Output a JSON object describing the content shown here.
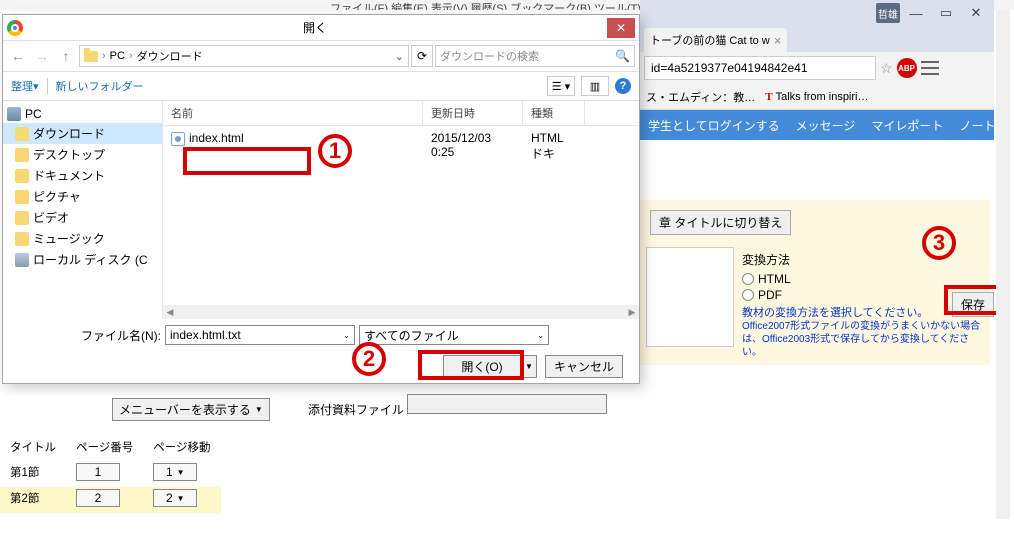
{
  "top_menu": "ファイル(F)   編集(E)   表示(V)   履歴(S)   ブックマーク(B)   ツール(T)   ヘルプ(H)",
  "browser": {
    "avatar": "哲雄",
    "tab_label": "トーブの前の猫  Cat to w",
    "url_fragment": "id=4a5219377e04194842e41",
    "bookmarks": [
      {
        "label": "ス・エムディン：教…"
      },
      {
        "label": "Talks from inspiri…"
      }
    ],
    "nav_items": [
      "学生としてログインする",
      "メッセージ",
      "マイレポート",
      "ノート"
    ]
  },
  "panel": {
    "switch_btn": "章 タイトルに切り替え",
    "method_label": "変換方法",
    "opts": [
      "HTML",
      "PDF"
    ],
    "help_link": "教材の変換方法を選択してください。",
    "small_note": "Office2007形式ファイルの変換がうまくいかない場合は、Office2003形式で保存してから変換してください。",
    "save": "保存"
  },
  "open_dialog": {
    "title": "開く",
    "crumb": {
      "root": "PC",
      "folder": "ダウンロード"
    },
    "search_placeholder": "ダウンロードの検索",
    "organize": "整理",
    "new_folder": "新しいフォルダー",
    "columns": {
      "name": "名前",
      "date": "更新日時",
      "type": "種類"
    },
    "nav_tree": [
      {
        "label": "PC",
        "root": true
      },
      {
        "label": "ダウンロード",
        "selected": true
      },
      {
        "label": "デスクトップ"
      },
      {
        "label": "ドキュメント"
      },
      {
        "label": "ピクチャ"
      },
      {
        "label": "ビデオ"
      },
      {
        "label": "ミュージック"
      },
      {
        "label": "ローカル ディスク (C"
      }
    ],
    "files": [
      {
        "name": "index.html",
        "date": "2015/12/03 0:25",
        "type": "HTML ドキ"
      }
    ],
    "filename_label": "ファイル名(N):",
    "filename_value": "index.html.txt",
    "filter_label": "すべてのファイル",
    "open_btn": "開く(O)",
    "cancel_btn": "キャンセル"
  },
  "attach_label": "添付資料ファイル",
  "bottom": {
    "menubar_select": "メニューバーを表示する",
    "headers": [
      "タイトル",
      "ページ番号",
      "ページ移動"
    ],
    "rows": [
      {
        "title": "第1節",
        "page": "1",
        "move": "1"
      },
      {
        "title": "第2節",
        "page": "2",
        "move": "2"
      }
    ]
  },
  "annotations": {
    "n1": "1",
    "n2": "2",
    "n3": "3"
  }
}
